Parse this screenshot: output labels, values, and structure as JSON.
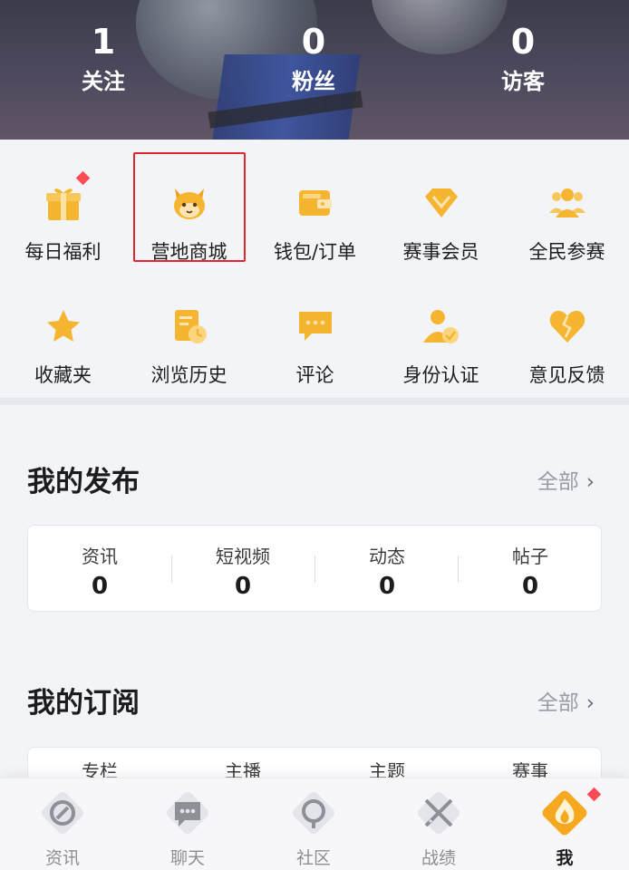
{
  "profile_stats": [
    {
      "value": "1",
      "label": "关注"
    },
    {
      "value": "0",
      "label": "粉丝"
    },
    {
      "value": "0",
      "label": "访客"
    }
  ],
  "grid_items": [
    {
      "label": "每日福利",
      "icon": "gift-icon"
    },
    {
      "label": "营地商城",
      "icon": "mascot-shop-icon"
    },
    {
      "label": "钱包/订单",
      "icon": "wallet-icon"
    },
    {
      "label": "赛事会员",
      "icon": "diamond-icon"
    },
    {
      "label": "全民参赛",
      "icon": "group-icon"
    },
    {
      "label": "收藏夹",
      "icon": "star-icon"
    },
    {
      "label": "浏览历史",
      "icon": "history-icon"
    },
    {
      "label": "评论",
      "icon": "comment-icon"
    },
    {
      "label": "身份认证",
      "icon": "verify-icon"
    },
    {
      "label": "意见反馈",
      "icon": "broken-heart-icon"
    }
  ],
  "my_posts": {
    "title": "我的发布",
    "all_label": "全部",
    "items": [
      {
        "label": "资讯",
        "value": "0"
      },
      {
        "label": "短视频",
        "value": "0"
      },
      {
        "label": "动态",
        "value": "0"
      },
      {
        "label": "帖子",
        "value": "0"
      }
    ]
  },
  "my_subscriptions": {
    "title": "我的订阅",
    "all_label": "全部",
    "items": [
      {
        "label": "专栏"
      },
      {
        "label": "主播"
      },
      {
        "label": "主题"
      },
      {
        "label": "赛事"
      }
    ]
  },
  "bottom_nav": [
    {
      "label": "资讯",
      "icon": "news-icon"
    },
    {
      "label": "聊天",
      "icon": "chat-icon"
    },
    {
      "label": "社区",
      "icon": "community-icon"
    },
    {
      "label": "战绩",
      "icon": "swords-icon"
    },
    {
      "label": "我",
      "icon": "me-icon"
    }
  ],
  "colors": {
    "accent": "#f7b731",
    "highlight_box": "#e0262f",
    "badge": "#ff4b55"
  }
}
